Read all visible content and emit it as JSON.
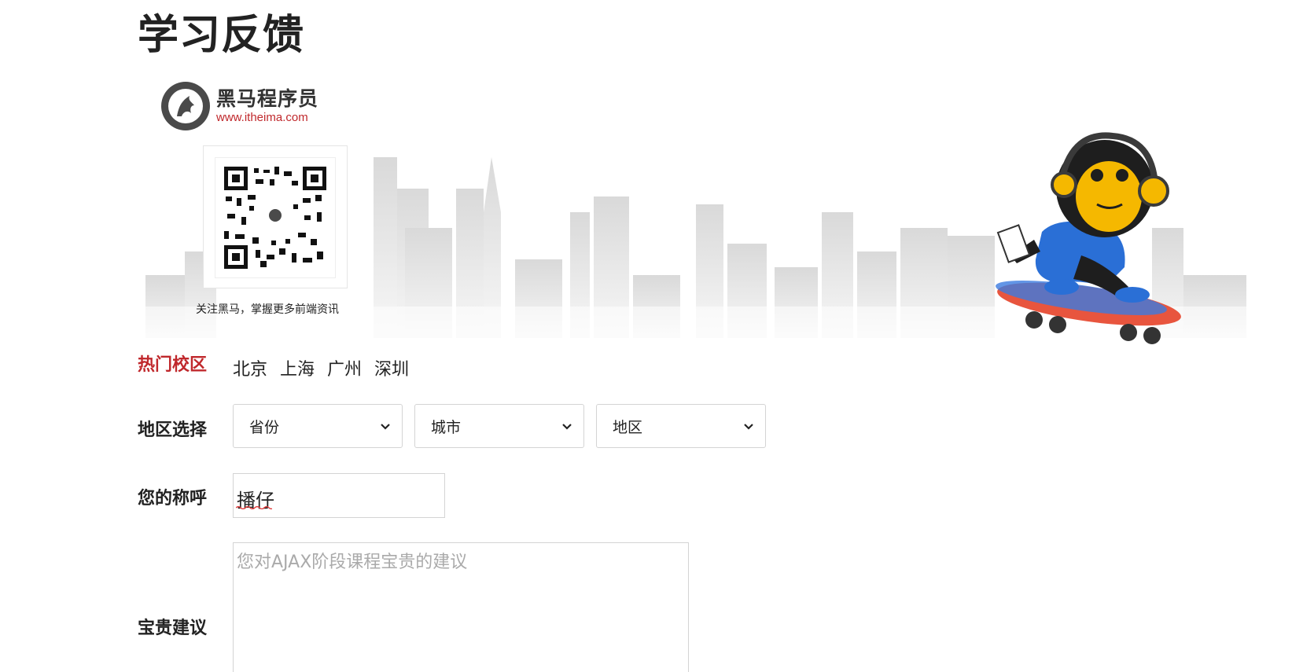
{
  "page": {
    "title": "学习反馈"
  },
  "banner": {
    "logo_name": "黑马程序员",
    "logo_url": "www.itheima.com",
    "qr_caption": "关注黑马，掌握更多前端资讯"
  },
  "campus": {
    "label": "热门校区",
    "items": [
      "北京",
      "上海",
      "广州",
      "深圳"
    ]
  },
  "region": {
    "label": "地区选择",
    "province": "省份",
    "city": "城市",
    "district": "地区"
  },
  "name": {
    "label": "您的称呼",
    "value": "播仔"
  },
  "advice": {
    "label": "宝贵建议",
    "placeholder": "您对AJAX阶段课程宝贵的建议"
  },
  "colors": {
    "accent": "#c0282c",
    "text": "#222222",
    "border": "#d4d4d4"
  },
  "icons": [
    "itheima-logo-icon",
    "qr-code-icon",
    "chevron-down-icon",
    "mascot-illustration"
  ]
}
